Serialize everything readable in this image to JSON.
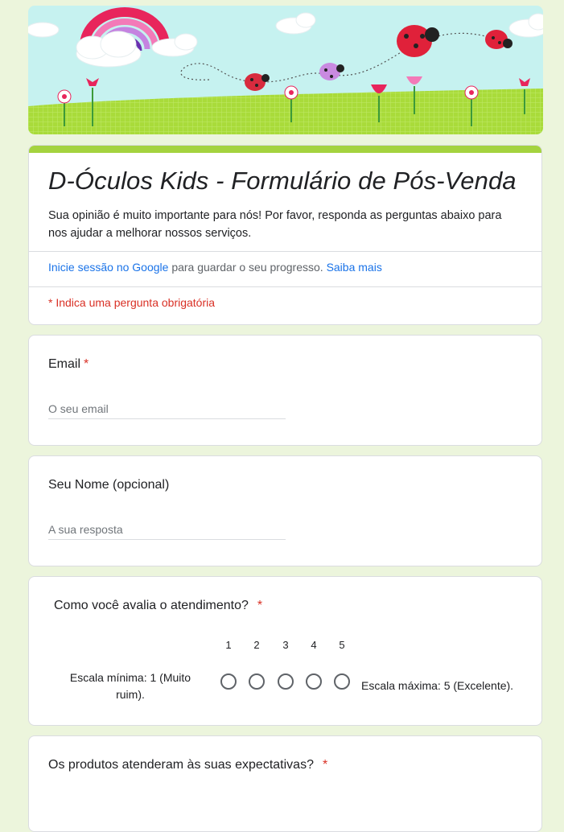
{
  "header": {
    "title": "D-Óculos Kids - Formulário de Pós-Venda",
    "description": "Sua opinião é muito importante para nós! Por favor, responda as perguntas abaixo para nos ajudar a melhorar nossos serviços.",
    "signin_link": "Inicie sessão no Google",
    "signin_text": " para guardar o seu progresso. ",
    "learn_more": "Saiba mais",
    "required_note": "* Indica uma pergunta obrigatória"
  },
  "questions": {
    "email": {
      "label": "Email",
      "required_mark": "*",
      "placeholder": "O seu email"
    },
    "name": {
      "label": "Seu Nome (opcional)",
      "placeholder": "A sua resposta"
    },
    "service": {
      "label": "Como você avalia o atendimento?",
      "required_mark": "*",
      "scale": [
        "1",
        "2",
        "3",
        "4",
        "5"
      ],
      "min_label": "Escala mínima: 1 (Muito ruim).",
      "max_label": "Escala máxima: 5 (Excelente)."
    },
    "products": {
      "label": "Os produtos atenderam às suas expectativas?",
      "required_mark": "*"
    }
  },
  "colors": {
    "background": "#ecf5dc",
    "accent": "#a4d33f",
    "link": "#1a73e8",
    "required": "#d93025"
  }
}
